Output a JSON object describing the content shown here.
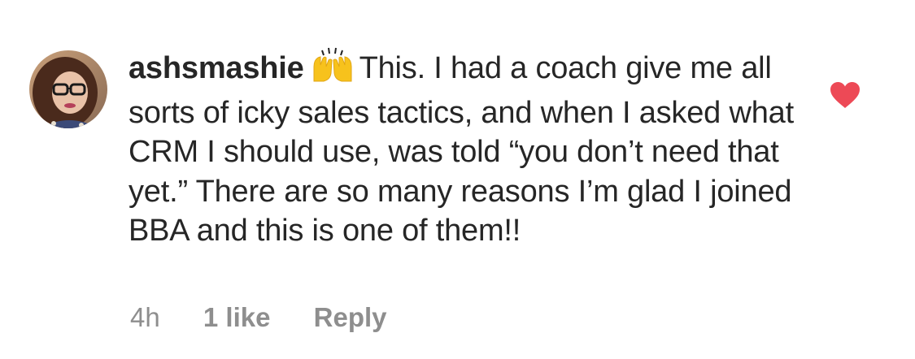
{
  "comment": {
    "username": "ashsmashie",
    "emoji": "raising-hands-emoji",
    "text": "This. I had a coach give me all sorts of icky sales tactics, and when I asked what CRM I should use, was told “you don’t need that yet.” There are so many reasons I’m glad I joined BBA and this is one of them!!",
    "time": "4h",
    "likes": "1 like",
    "reply_label": "Reply",
    "liked": true
  },
  "icons": {
    "heart": "heart-icon",
    "heart_color": "#ed4956"
  },
  "colors": {
    "text": "#262626",
    "meta": "#8e8e8e"
  }
}
